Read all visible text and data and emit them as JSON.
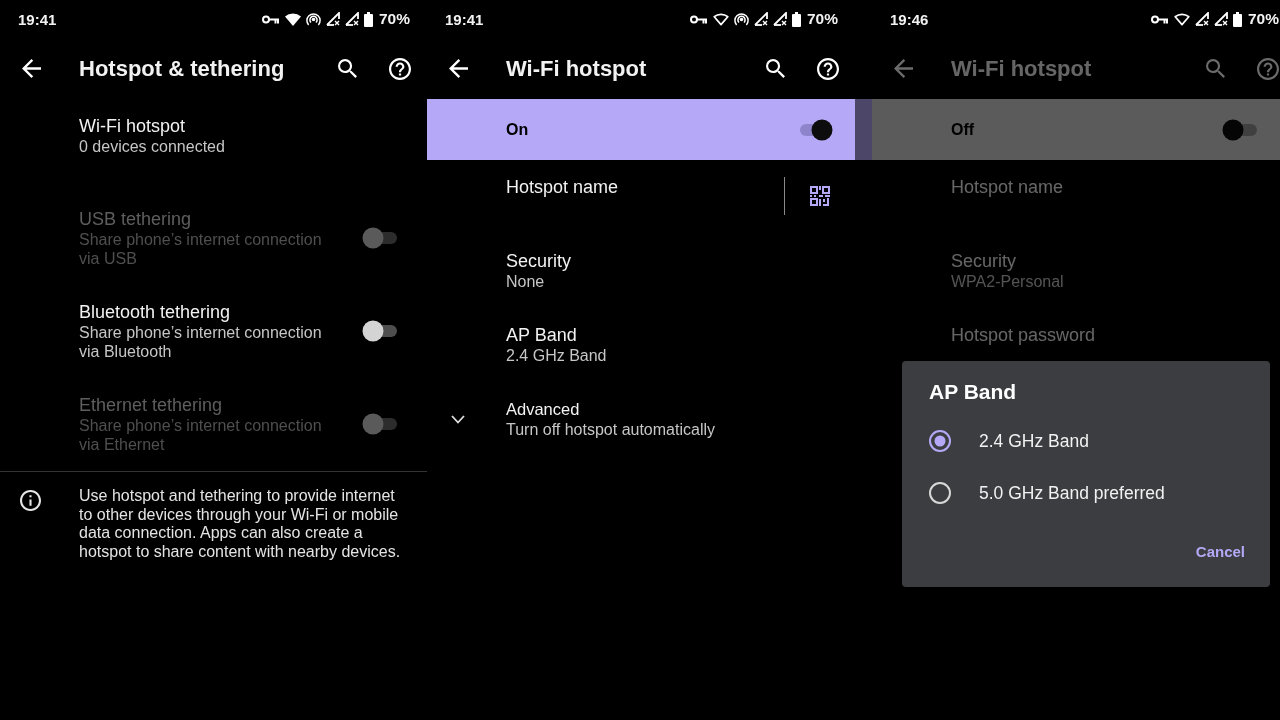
{
  "screens": [
    {
      "dimmed": false,
      "status_bar": {
        "time": "19:41",
        "icons": [
          {
            "kind": "key"
          },
          {
            "kind": "wifi"
          },
          {
            "kind": "hotspot"
          },
          {
            "kind": "signal_off"
          },
          {
            "kind": "signal_off"
          },
          {
            "kind": "battery"
          }
        ],
        "battery": "70%"
      },
      "app_bar": {
        "title": "Hotspot & tethering"
      },
      "items": [
        {
          "kind": "text",
          "title": "Wi-Fi hotspot",
          "summary": "0 devices connected",
          "disabled": false
        },
        {
          "kind": "switch",
          "title": "USB tethering",
          "summary": "Share phone’s internet connection via USB",
          "disabled": true,
          "on": false
        },
        {
          "kind": "switch",
          "title": "Bluetooth tethering",
          "summary": "Share phone’s internet connection via Bluetooth",
          "disabled": false,
          "on": false
        },
        {
          "kind": "switch",
          "title": "Ethernet tethering",
          "summary": "Share phone’s internet connection via Ethernet",
          "disabled": true,
          "on": false
        }
      ],
      "footer": {
        "text": "Use hotspot and tethering to provide internet to other devices through your Wi-Fi or mobile data connection. Apps can also create a hotspot to share content with nearby devices."
      }
    },
    {
      "dimmed": false,
      "status_bar": {
        "time": "19:41",
        "icons": [
          {
            "kind": "key"
          },
          {
            "kind": "wifi_outline"
          },
          {
            "kind": "hotspot"
          },
          {
            "kind": "signal_off"
          },
          {
            "kind": "signal_off"
          },
          {
            "kind": "battery"
          }
        ],
        "battery": "70%"
      },
      "app_bar": {
        "title": "Wi-Fi hotspot"
      },
      "main_switch": {
        "label": "On",
        "on": true
      },
      "items": [
        {
          "kind": "qr",
          "title": "Hotspot name"
        },
        {
          "kind": "text",
          "title": "Security",
          "summary": "None"
        },
        {
          "kind": "text",
          "title": "AP Band",
          "summary": "2.4 GHz Band"
        },
        {
          "kind": "expand",
          "title": "Advanced",
          "summary": "Turn off hotspot automatically"
        }
      ]
    },
    {
      "dimmed": true,
      "status_bar": {
        "time": "19:46",
        "icons": [
          {
            "kind": "key"
          },
          {
            "kind": "wifi_outline"
          },
          {
            "kind": "signal_off"
          },
          {
            "kind": "signal_off"
          },
          {
            "kind": "battery"
          }
        ],
        "battery": "70%"
      },
      "app_bar": {
        "title": "Wi-Fi hotspot"
      },
      "main_switch": {
        "label": "Off",
        "on": false
      },
      "items": [
        {
          "kind": "text",
          "title": "Hotspot name"
        },
        {
          "kind": "text",
          "title": "Security",
          "summary": "WPA2-Personal"
        },
        {
          "kind": "text",
          "title": "Hotspot password"
        }
      ],
      "dialog": {
        "title": "AP Band",
        "options": [
          {
            "label": "2.4 GHz Band",
            "selected": true
          },
          {
            "label": "5.0 GHz Band preferred",
            "selected": false
          }
        ],
        "button": "Cancel"
      }
    }
  ]
}
